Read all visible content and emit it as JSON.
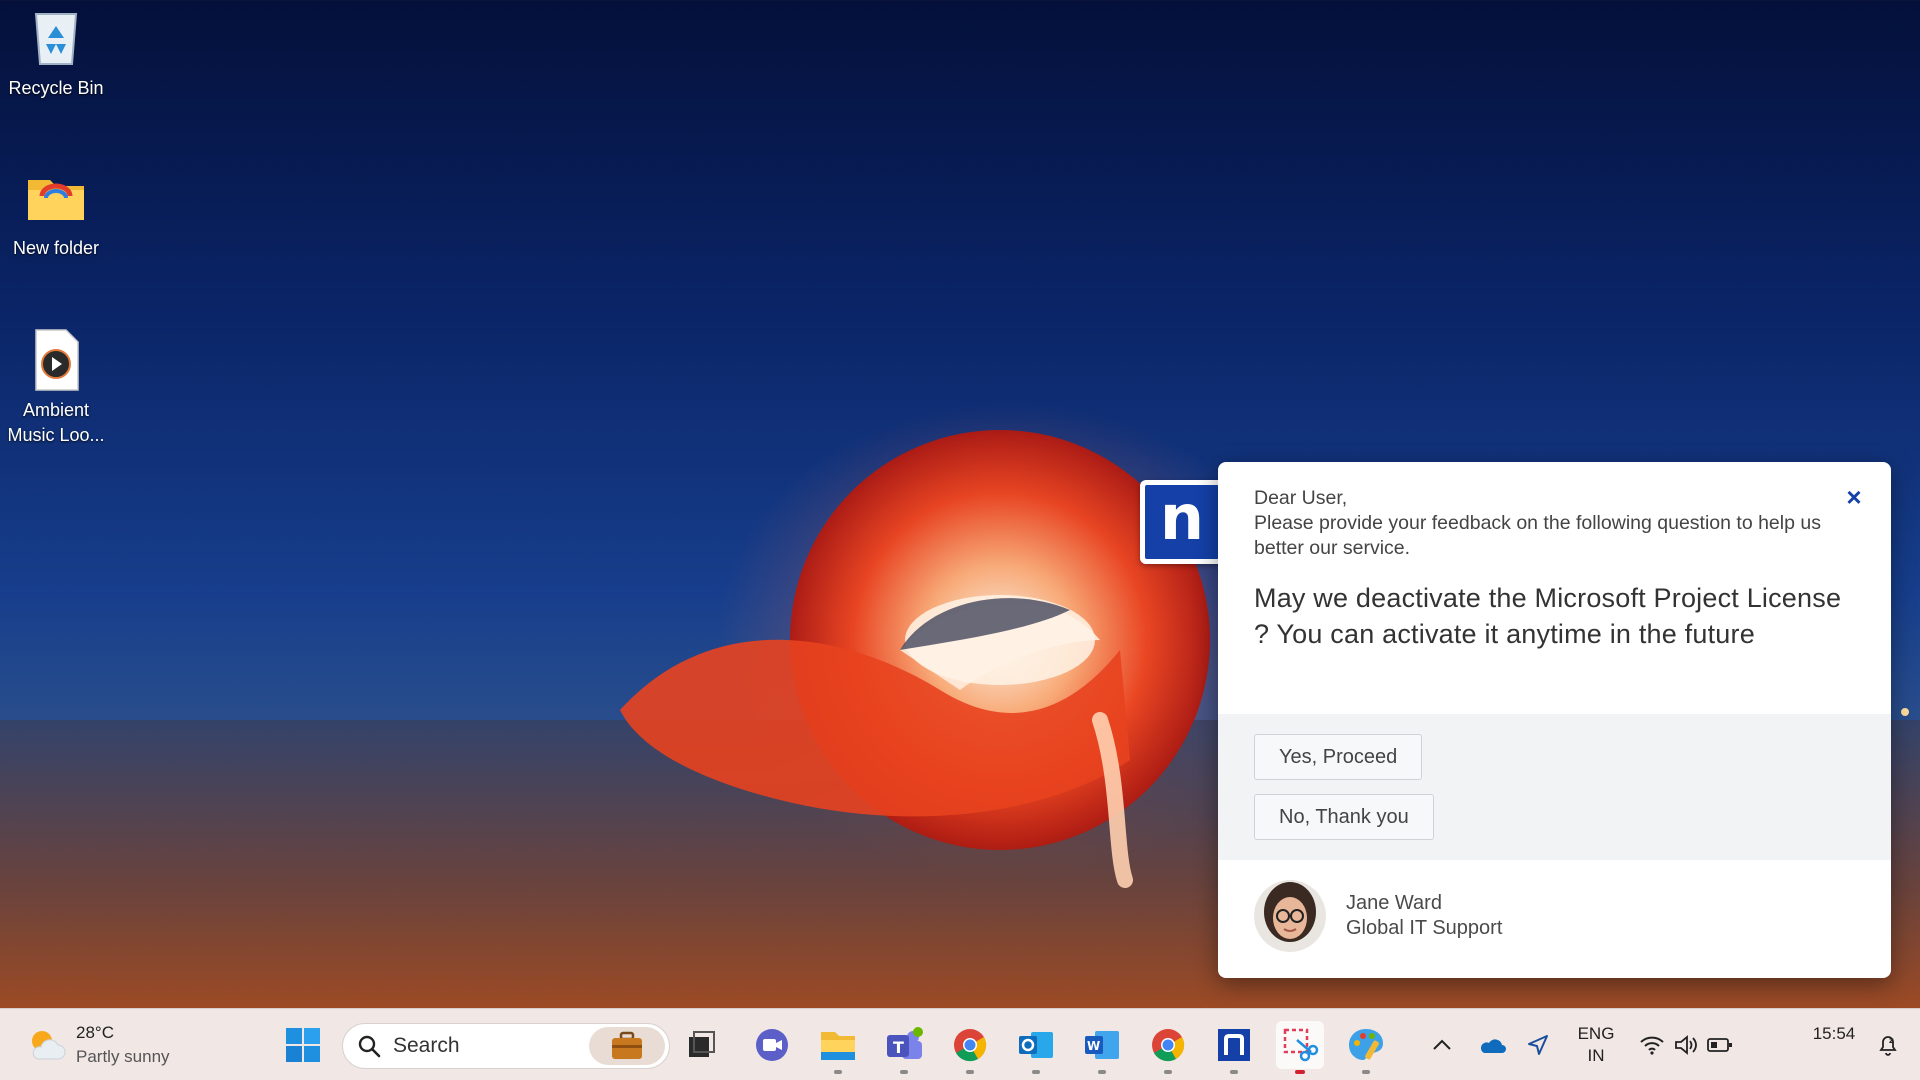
{
  "desktop": {
    "icons": [
      {
        "label": "Recycle Bin",
        "icon": "recycle-bin-icon"
      },
      {
        "label": "New folder",
        "icon": "folder-icon"
      },
      {
        "label": "Ambient Music Loo...",
        "icon": "media-file-icon"
      }
    ]
  },
  "popup": {
    "badge_letter": "n",
    "greeting_line1": "Dear User,",
    "greeting_line2": "Please provide your feedback on the following question to help us better our service.",
    "question": "May we deactivate the Microsoft Project License ? You can activate it anytime in the future",
    "options": [
      "Yes, Proceed",
      "No, Thank you"
    ],
    "agent_name": "Jane Ward",
    "agent_title": "Global IT Support",
    "close_glyph": "×",
    "colors": {
      "accent": "#1440a8",
      "panel": "#f2f3f5"
    }
  },
  "taskbar": {
    "weather": {
      "temp": "28°C",
      "condition": "Partly sunny"
    },
    "search": {
      "placeholder": "Search"
    },
    "apps": [
      "start-icon",
      "task-view-icon",
      "meet-icon",
      "file-explorer-icon",
      "teams-icon",
      "chrome-icon",
      "outlook-icon",
      "word-icon",
      "chrome-profile-icon",
      "nexthink-icon",
      "snipping-tool-icon",
      "paint-icon"
    ],
    "tray": {
      "language": "ENG",
      "region": "IN",
      "time": "15:54"
    }
  }
}
